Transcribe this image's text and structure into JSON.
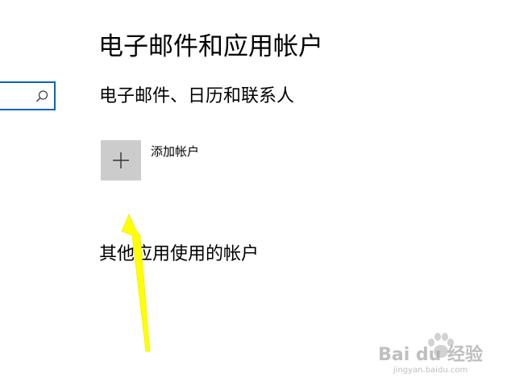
{
  "search": {
    "value": "",
    "icon": "search-icon"
  },
  "page": {
    "title": "电子邮件和应用帐户"
  },
  "email_section": {
    "title": "电子邮件、日历和联系人",
    "add_account_label": "添加帐户",
    "add_icon": "plus-icon"
  },
  "other_section": {
    "title": "其他应用使用的帐户"
  },
  "annotation": {
    "color": "#ffff00"
  },
  "watermark": {
    "main": "Bai du 经验",
    "sub": "jingyan.baidu.com"
  },
  "colors": {
    "accent": "#0a64c8",
    "tile": "#cccccc"
  }
}
